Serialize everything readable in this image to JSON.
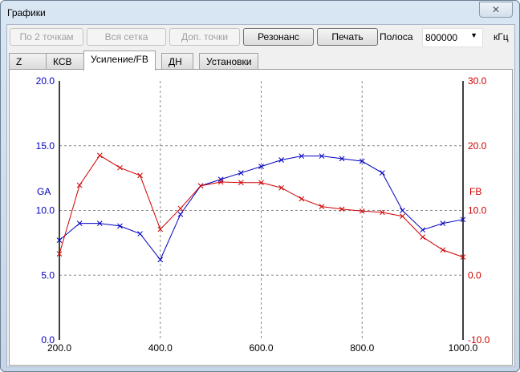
{
  "window": {
    "title": "Графики",
    "close_icon": "close-icon"
  },
  "toolbar": {
    "btn_two_points": "По 2 точкам",
    "btn_full_grid": "Вся сетка",
    "btn_extra_points": "Доп. точки",
    "btn_resonance": "Резонанс",
    "btn_print": "Печать",
    "band_label": "Полоса",
    "band_value": "800000",
    "unit": "кГц"
  },
  "tabs": [
    "Z",
    "КСВ",
    "Усиление/FB",
    "ДН",
    "Установки"
  ],
  "colors": {
    "ga": "#0000c0",
    "fb": "#d00000"
  },
  "chart_data": {
    "type": "line",
    "x": [
      200,
      240,
      280,
      320,
      360,
      400,
      440,
      480,
      520,
      560,
      600,
      640,
      680,
      720,
      760,
      800,
      840,
      880,
      920,
      960,
      1000
    ],
    "xlim": [
      200,
      1000
    ],
    "xticks": [
      "200.0",
      "400.0",
      "600.0",
      "800.0",
      "1000.0"
    ],
    "series": [
      {
        "name": "GA",
        "axis": "left",
        "values": [
          7.7,
          9.0,
          9.0,
          8.8,
          8.2,
          6.2,
          9.7,
          11.9,
          12.4,
          12.9,
          13.4,
          13.9,
          14.2,
          14.2,
          14.0,
          13.8,
          12.9,
          10.0,
          8.5,
          9.0,
          9.3
        ]
      },
      {
        "name": "FB",
        "axis": "right",
        "values": [
          3.3,
          13.9,
          18.5,
          16.6,
          15.4,
          7.1,
          10.3,
          13.8,
          14.4,
          14.3,
          14.3,
          13.5,
          11.8,
          10.6,
          10.2,
          9.9,
          9.7,
          9.1,
          5.9,
          3.9,
          2.8
        ]
      }
    ],
    "ylim_left": [
      0,
      20
    ],
    "yticks_left": [
      "0.0",
      "5.0",
      "10.0",
      "15.0",
      "20.0"
    ],
    "ylabel_left": "GA",
    "ylim_right": [
      -10,
      30
    ],
    "yticks_right": [
      "-10.0",
      "0.0",
      "10.0",
      "20.0",
      "30.0"
    ],
    "ylabel_right": "FB",
    "grid": true
  }
}
